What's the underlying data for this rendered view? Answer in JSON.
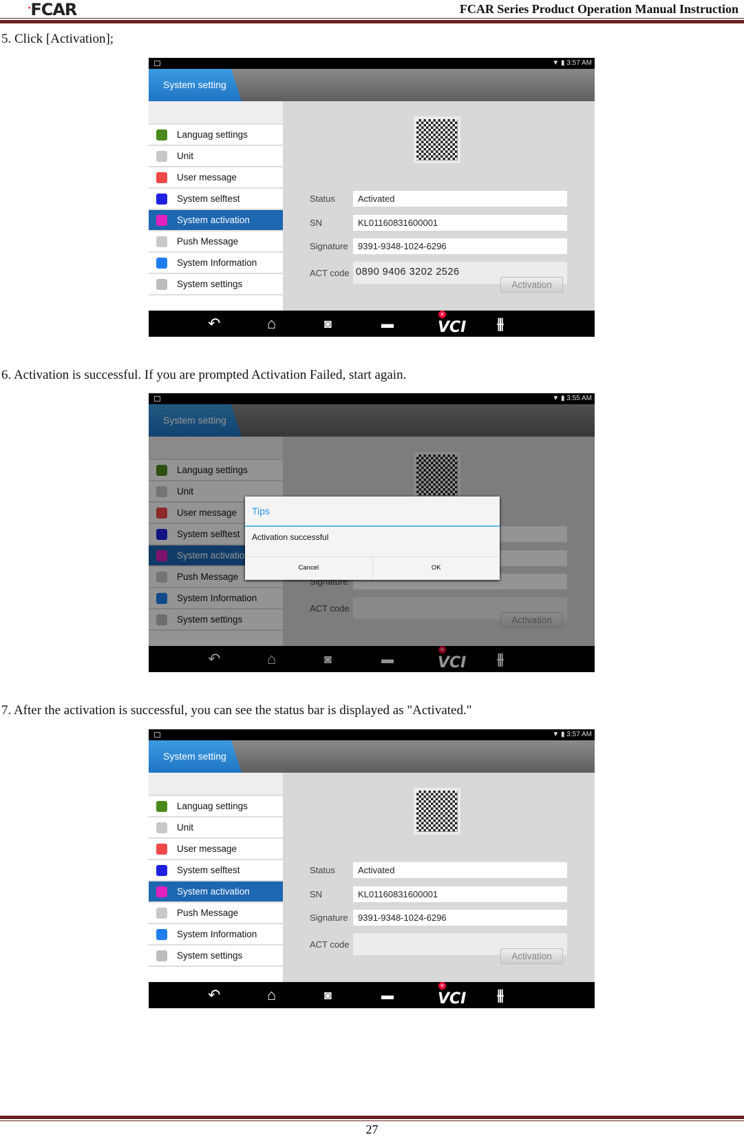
{
  "header": {
    "logo": "FCAR",
    "title": "FCAR Series Product  Operation Manual Instruction"
  },
  "steps": [
    "5. Click [Activation];",
    "6. Activation is successful. If you are prompted Activation Failed, start again.",
    "7. After the activation is successful, you can see the status bar is displayed as \"Activated.\""
  ],
  "page_number": "27",
  "sidebar_items": [
    {
      "label": "Languag settings",
      "color": "#4a8a1c"
    },
    {
      "label": "Unit",
      "color": "#c8c8c8"
    },
    {
      "label": "User message",
      "color": "#f04848"
    },
    {
      "label": "System selftest",
      "color": "#2020e0"
    },
    {
      "label": "System activation",
      "color": "#e020c0"
    },
    {
      "label": "Push Message",
      "color": "#c8c8c8"
    },
    {
      "label": "System Information",
      "color": "#1e7ef0"
    },
    {
      "label": "System settings",
      "color": "#bdbdbd"
    }
  ],
  "labels": {
    "status": "Status",
    "sn": "SN",
    "signature": "Signature",
    "act_code": "ACT code",
    "activation_button": "Activation",
    "title": "System setting"
  },
  "bottom_bar": {
    "vci": "VCI"
  },
  "screens": [
    {
      "time": "3:57 AM",
      "status": "Activated",
      "sn": "KL01160831600001",
      "signature": "9391-9348-1024-6296",
      "act_code": "0890 9406 3202 2526"
    },
    {
      "time": "3:55 AM",
      "status": "",
      "sn": "",
      "signature": "",
      "act_code": "",
      "dialog": {
        "title": "Tips",
        "message": "Activation successful",
        "cancel": "Cancel",
        "ok": "OK"
      }
    },
    {
      "time": "3:57 AM",
      "status": "Activated",
      "sn": "KL01160831600001",
      "signature": "9391-9348-1024-6296",
      "act_code": ""
    }
  ],
  "colors": {
    "accent": "#1d66b0",
    "rule": "#6b2020",
    "dialog_title": "#2a97e8"
  }
}
